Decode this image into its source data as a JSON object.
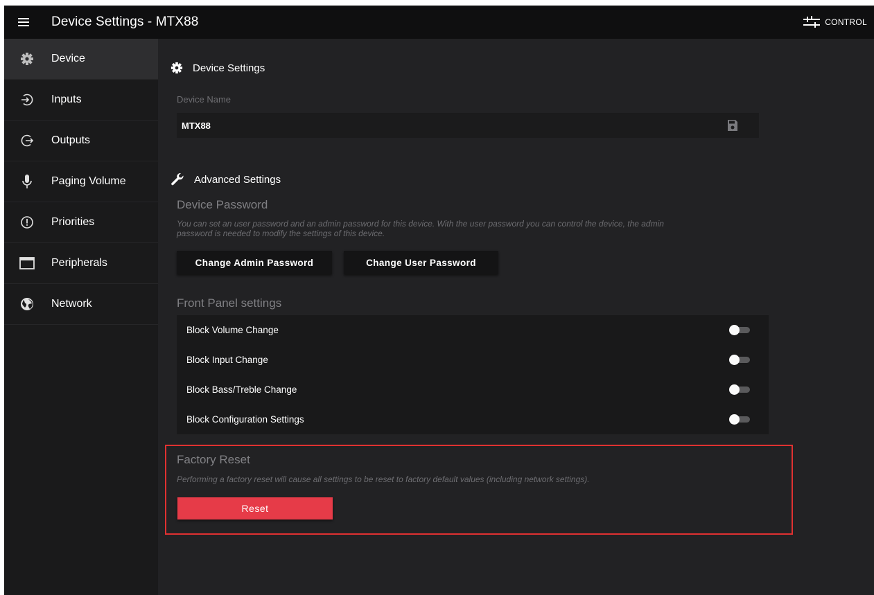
{
  "header": {
    "title": "Device Settings - MTX88",
    "control_label": "CONTROL"
  },
  "sidebar": {
    "items": [
      {
        "label": "Device",
        "icon": "gear-icon",
        "active": true
      },
      {
        "label": "Inputs",
        "icon": "input-arrow-icon",
        "active": false
      },
      {
        "label": "Outputs",
        "icon": "output-arrow-icon",
        "active": false
      },
      {
        "label": "Paging Volume",
        "icon": "microphone-icon",
        "active": false
      },
      {
        "label": "Priorities",
        "icon": "priority-exclamation-icon",
        "active": false
      },
      {
        "label": "Peripherals",
        "icon": "window-icon",
        "active": false
      },
      {
        "label": "Network",
        "icon": "globe-icon",
        "active": false
      }
    ]
  },
  "device_settings": {
    "heading": "Device Settings",
    "name_label": "Device Name",
    "name_value": "MTX88"
  },
  "advanced": {
    "heading": "Advanced Settings",
    "password_title": "Device Password",
    "password_desc_line1": "You can set an user password and an admin password for this device. With the user password you can control the device, the admin",
    "password_desc_line2": "password is needed to modify the settings of this device.",
    "admin_button": "Change Admin Password",
    "user_button": "Change User Password",
    "front_panel_title": "Front Panel settings",
    "toggles": [
      {
        "label": "Block Volume Change",
        "on": false
      },
      {
        "label": "Block Input Change",
        "on": false
      },
      {
        "label": "Block Bass/Treble Change",
        "on": false
      },
      {
        "label": "Block Configuration Settings",
        "on": false
      }
    ]
  },
  "factory_reset": {
    "title": "Factory Reset",
    "desc": "Performing a factory reset will cause all settings to be reset to factory default values (including network settings).",
    "button": "Reset"
  },
  "colors": {
    "background": "#222224",
    "topbar": "#0f0f10",
    "sidebar": "#1a1a1b",
    "reset_button": "#e63b48",
    "highlight_border": "#e03131"
  }
}
